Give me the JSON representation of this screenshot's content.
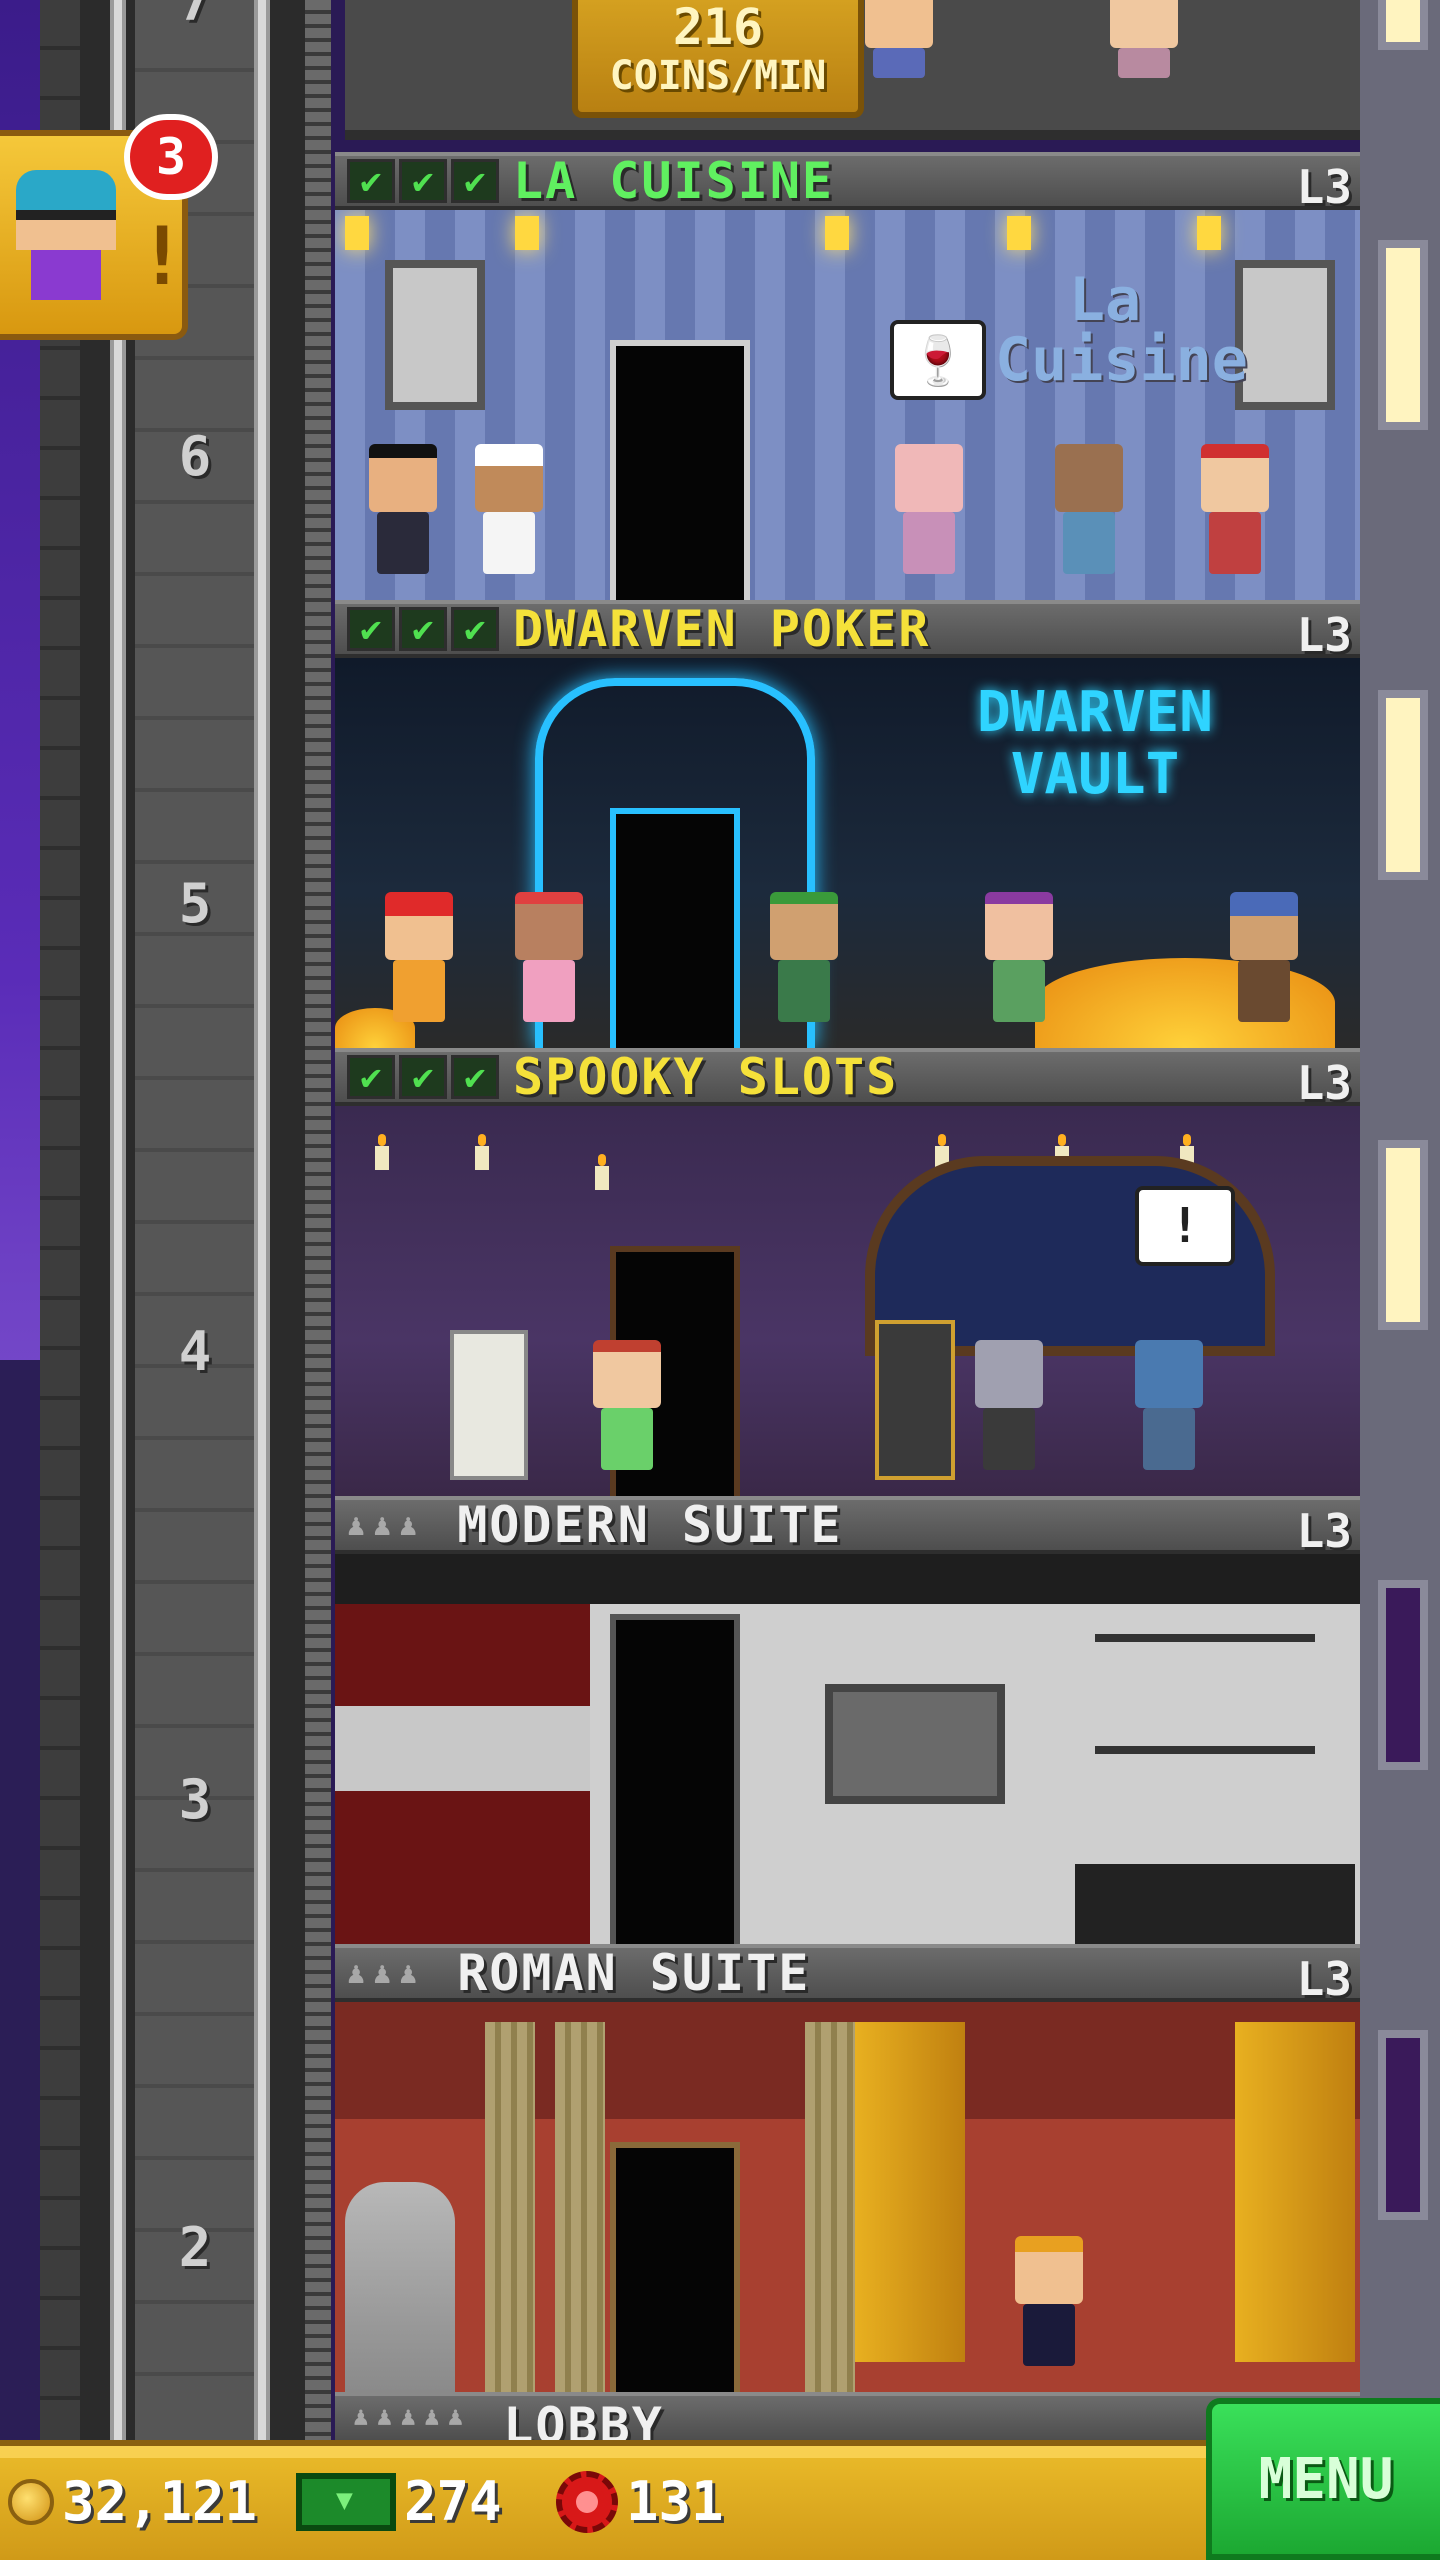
{
  "top_floor": {
    "floor_number": "7",
    "coins_rate_value": "216",
    "coins_rate_unit": "COINS/MIN"
  },
  "notification": {
    "badge_count": "3",
    "exclaim": "!"
  },
  "floors": [
    {
      "number": "6",
      "name": "LA CUISINE",
      "level": "L3",
      "status": "checks",
      "sign": "La Cuisine",
      "bubble": "🍷"
    },
    {
      "number": "5",
      "name": "DWARVEN POKER",
      "level": "L3",
      "status": "checks",
      "sign": "DWARVEN VAULT"
    },
    {
      "number": "4",
      "name": "SPOOKY SLOTS",
      "level": "L3",
      "status": "checks",
      "bubble": "!"
    },
    {
      "number": "3",
      "name": "MODERN SUITE",
      "level": "L3",
      "status": "people"
    },
    {
      "number": "2",
      "name": "ROMAN SUITE",
      "level": "L3",
      "status": "people"
    },
    {
      "name": "LOBBY",
      "status": "people"
    }
  ],
  "status_bar": {
    "coins": "32,121",
    "bux": "274",
    "gems": "131",
    "menu_label": "MENU"
  },
  "colors": {
    "check_green": "#60f060",
    "title_yellow": "#f5e13a",
    "menu_green": "#1ca832",
    "bar_gold": "#e8b828"
  }
}
